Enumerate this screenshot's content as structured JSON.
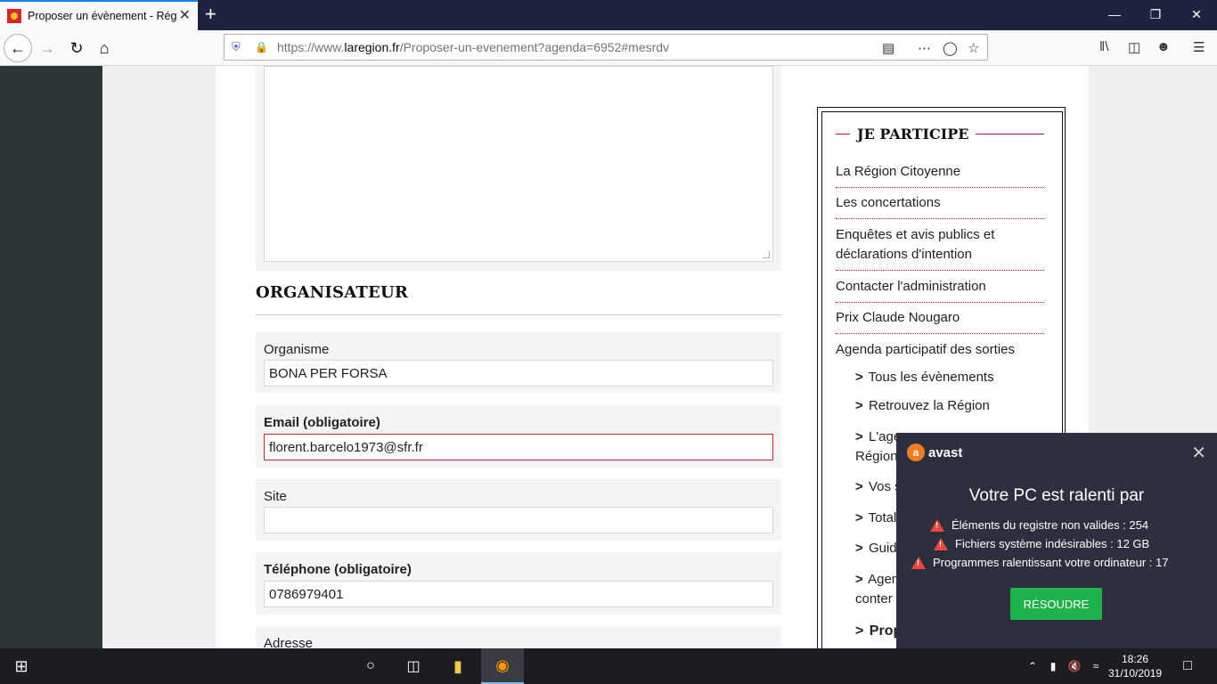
{
  "browser": {
    "tab_title": "Proposer un évènement - Régio",
    "tab_close": "✕",
    "new_tab": "+",
    "url_prefix": "https://www.",
    "url_domain": "laregion.fr",
    "url_path": "/Proposer-un-evenement?agenda=6952#mesrdv",
    "icons": [
      "back-icon",
      "forward-icon",
      "reload-icon",
      "home-icon",
      "shield-icon",
      "lock-icon",
      "reader-view-icon",
      "more-actions-icon",
      "pocket-icon",
      "bookmark-star-icon",
      "library-icon",
      "sidebar-icon",
      "account-icon",
      "menu-icon"
    ]
  },
  "form": {
    "section_title": "ORGANISATEUR",
    "fields": [
      {
        "label": "Organisme",
        "value": "BONA PER FORSA",
        "required": false
      },
      {
        "label": "Email (obligatoire)",
        "value": "florent.barcelo1973@sfr.fr",
        "required": true,
        "error": true
      },
      {
        "label": "Site",
        "value": "",
        "required": false
      },
      {
        "label": "Téléphone (obligatoire)",
        "value": "0786979401",
        "required": true
      },
      {
        "label": "Adresse",
        "value": "",
        "required": false
      }
    ]
  },
  "sidebar": {
    "heading": "JE PARTICIPE",
    "items": [
      "La Région Citoyenne",
      "Les concertations",
      "Enquêtes et avis publics et déclarations d'intention",
      "Contacter l'administration",
      "Prix Claude Nougaro",
      "Agenda participatif des sorties"
    ],
    "subitems": [
      "Tous les évènements",
      "Retrouvez la Région",
      "L'age",
      "Région",
      "Vos s",
      "Total",
      "Guide",
      "Agen",
      "conter",
      "Prop"
    ],
    "subitem_marker": ">"
  },
  "avast": {
    "brand": "avast",
    "close": "✕",
    "headline": "Votre PC est ralenti par",
    "warnings": [
      "Éléments du registre non valides : 254",
      "Fichiers système indésirables : 12 GB",
      "Programmes ralentissant votre ordinateur : 17"
    ],
    "button": "RÉSOUDRE"
  },
  "taskbar": {
    "time": "18:26",
    "date": "31/10/2019"
  },
  "colors": {
    "accent_red": "#b01c2b",
    "avast_bg": "#2d2f3f",
    "avast_button": "#1fb14b",
    "titlebar": "#20233f"
  }
}
